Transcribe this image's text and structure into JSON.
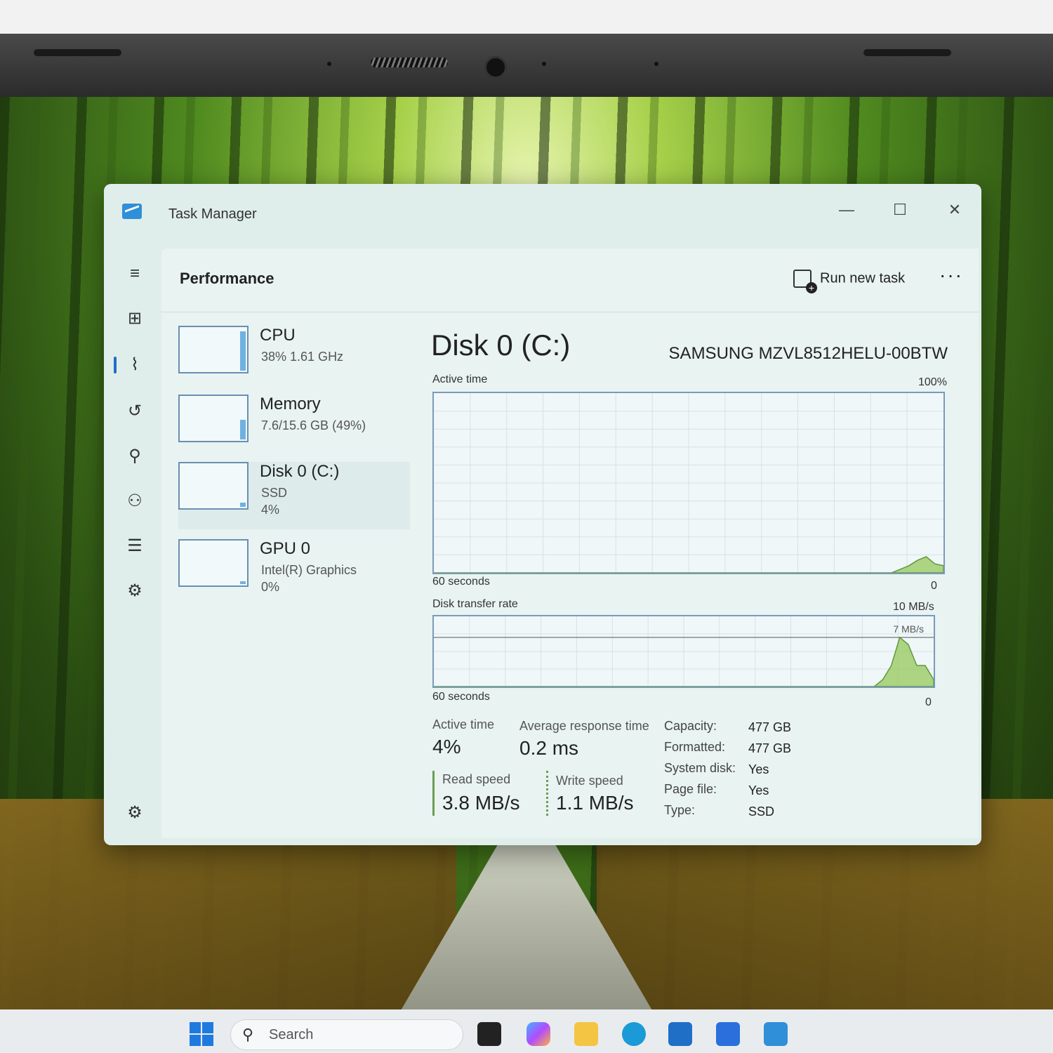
{
  "window": {
    "title": "Task Manager"
  },
  "content": {
    "page_title": "Performance",
    "run_new_task": "Run new task",
    "more": "···"
  },
  "devices": [
    {
      "name": "CPU",
      "sub1": "38%  1.61 GHz",
      "sub2": ""
    },
    {
      "name": "Memory",
      "sub1": "7.6/15.6 GB (49%)",
      "sub2": ""
    },
    {
      "name": "Disk 0 (C:)",
      "sub1": "SSD",
      "sub2": "4%"
    },
    {
      "name": "GPU 0",
      "sub1": "Intel(R) Graphics",
      "sub2": "0%"
    }
  ],
  "detail": {
    "title": "Disk 0 (C:)",
    "model": "SAMSUNG MZVL8512HELU-00BTW",
    "graph1": {
      "label": "Active time",
      "max": "100%",
      "time": "60 seconds",
      "min": "0"
    },
    "graph2": {
      "label": "Disk transfer rate",
      "max": "10 MB/s",
      "inner": "7 MB/s",
      "time": "60 seconds",
      "min": "0"
    },
    "stats": {
      "active_time_label": "Active time",
      "active_time_value": "4%",
      "avg_resp_label": "Average response time",
      "avg_resp_value": "0.2 ms",
      "read_label": "Read speed",
      "read_value": "3.8 MB/s",
      "write_label": "Write speed",
      "write_value": "1.1 MB/s"
    },
    "props": [
      {
        "k": "Capacity:",
        "v": "477 GB"
      },
      {
        "k": "Formatted:",
        "v": "477 GB"
      },
      {
        "k": "System disk:",
        "v": "Yes"
      },
      {
        "k": "Page file:",
        "v": "Yes"
      },
      {
        "k": "Type:",
        "v": "SSD"
      }
    ]
  },
  "chart_data": [
    {
      "type": "area",
      "title": "Active time",
      "ylim": [
        0,
        100
      ],
      "x_label": "60 seconds",
      "values": [
        0,
        0,
        0,
        0,
        0,
        0,
        0,
        0,
        0,
        0,
        0,
        0,
        0,
        0,
        0,
        0,
        0,
        0,
        0,
        0,
        0,
        0,
        0,
        0,
        0,
        0,
        0,
        0,
        0,
        0,
        0,
        0,
        0,
        0,
        0,
        0,
        0,
        0,
        0,
        0,
        0,
        0,
        0,
        0,
        0,
        0,
        0,
        0,
        0,
        0,
        0,
        0,
        0,
        0,
        2,
        4,
        7,
        9,
        5,
        4
      ]
    },
    {
      "type": "area",
      "title": "Disk transfer rate",
      "ylim": [
        0,
        10
      ],
      "y_max_label": "10 MB/s",
      "x_label": "60 seconds",
      "values": [
        0,
        0,
        0,
        0,
        0,
        0,
        0,
        0,
        0,
        0,
        0,
        0,
        0,
        0,
        0,
        0,
        0,
        0,
        0,
        0,
        0,
        0,
        0,
        0,
        0,
        0,
        0,
        0,
        0,
        0,
        0,
        0,
        0,
        0,
        0,
        0,
        0,
        0,
        0,
        0,
        0,
        0,
        0,
        0,
        0,
        0,
        0,
        0,
        0,
        0,
        0,
        0,
        0,
        1,
        3,
        7,
        6,
        3,
        3,
        1
      ]
    }
  ],
  "taskbar": {
    "search_placeholder": "Search"
  }
}
